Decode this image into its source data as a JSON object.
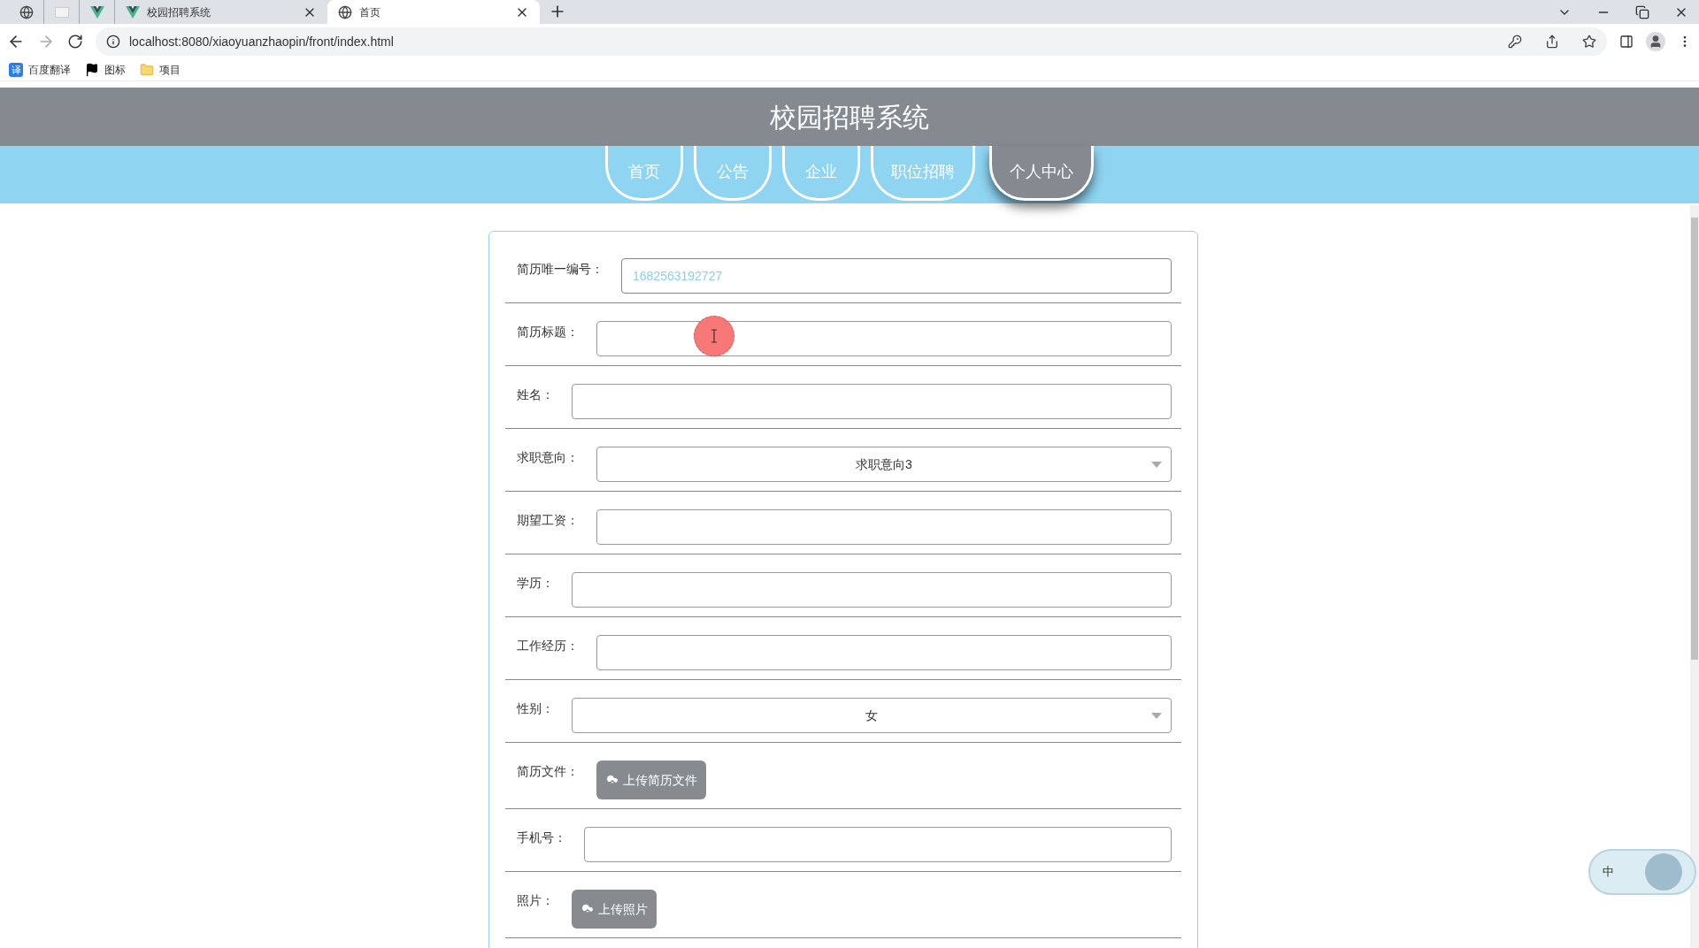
{
  "browser": {
    "tabs": [
      {
        "kind": "pinned",
        "selected": false
      },
      {
        "kind": "pinned",
        "selected": false
      },
      {
        "kind": "pinned",
        "selected": false
      },
      {
        "kind": "tab",
        "title": "校园招聘系统",
        "selected": false
      },
      {
        "kind": "tab",
        "title": "首页",
        "selected": true
      }
    ],
    "url": "localhost:8080/xiaoyuanzhaopin/front/index.html",
    "bookmarks": [
      {
        "badge": "译",
        "label": "百度翻译"
      },
      {
        "label": "图标"
      },
      {
        "label": "项目"
      }
    ]
  },
  "header": {
    "title": "校园招聘系统"
  },
  "nav": [
    {
      "label": "首页",
      "selected": false
    },
    {
      "label": "公告",
      "selected": false
    },
    {
      "label": "企业",
      "selected": false
    },
    {
      "label": "职位招聘",
      "selected": false
    },
    {
      "label": "个人中心",
      "selected": true
    }
  ],
  "form": [
    {
      "kind": "text",
      "label": "简历唯一编号：",
      "value": "1682563192727",
      "readonly": true
    },
    {
      "kind": "text",
      "label": "简历标题："
    },
    {
      "kind": "text",
      "label": "姓名："
    },
    {
      "kind": "select",
      "label": "求职意向：",
      "value": "求职意向3"
    },
    {
      "kind": "text",
      "label": "期望工资："
    },
    {
      "kind": "text",
      "label": "学历："
    },
    {
      "kind": "text",
      "label": "工作经历："
    },
    {
      "kind": "select",
      "label": "性别：",
      "value": "女"
    },
    {
      "kind": "upload",
      "label": "简历文件：",
      "button": "上传简历文件"
    },
    {
      "kind": "text",
      "label": "手机号："
    },
    {
      "kind": "upload",
      "label": "照片：",
      "button": "上传照片"
    }
  ],
  "ime": {
    "label": "中"
  }
}
